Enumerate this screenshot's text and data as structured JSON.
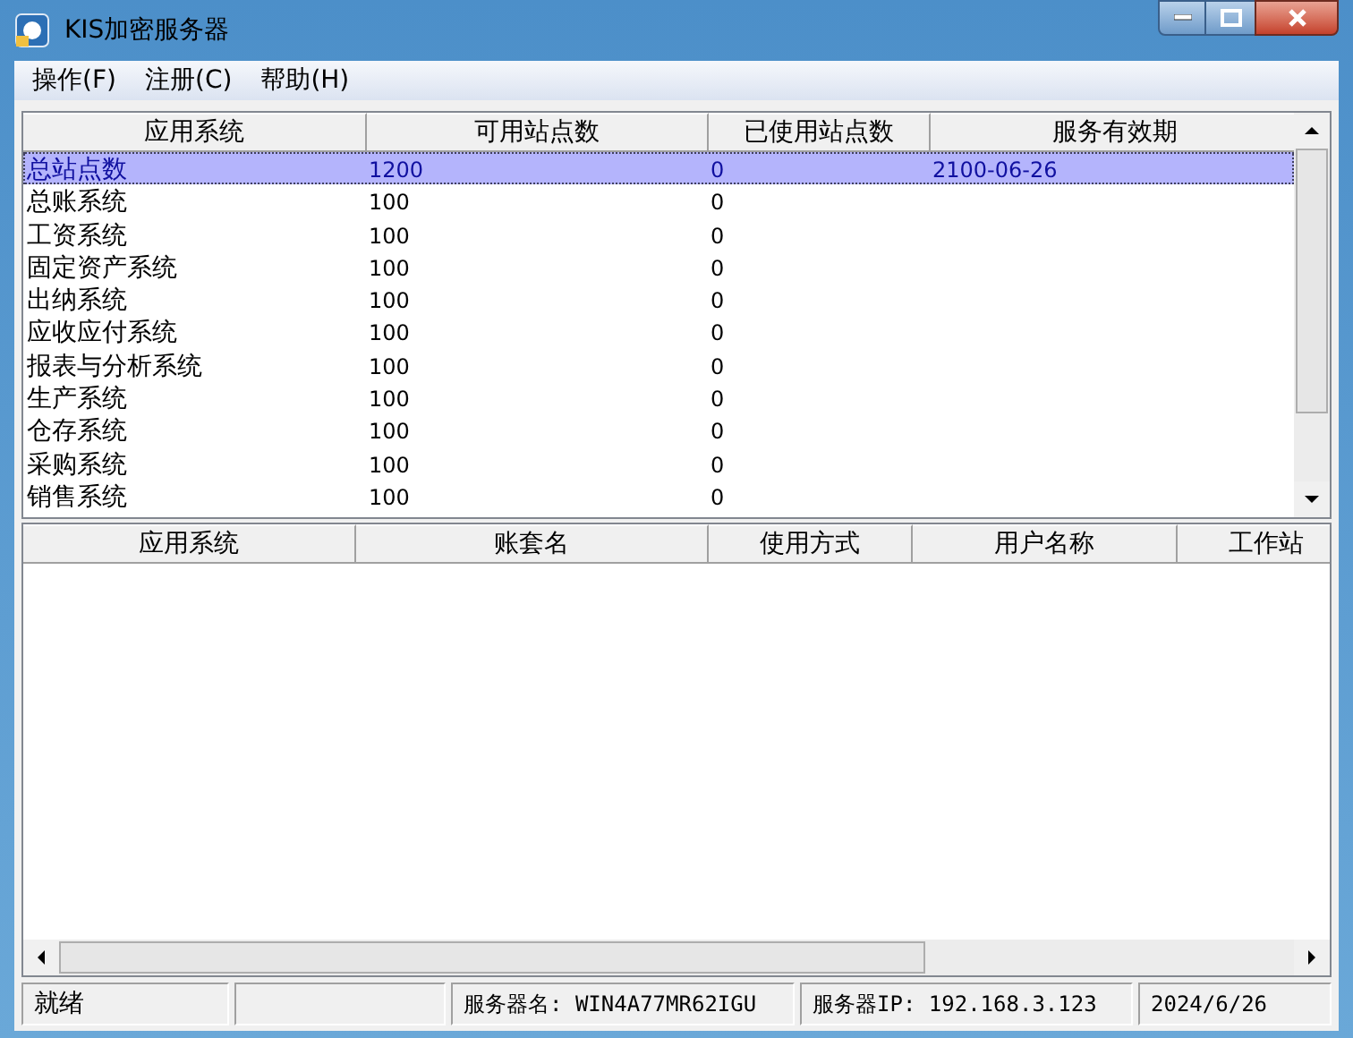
{
  "window": {
    "title": "KIS加密服务器"
  },
  "menu": [
    "操作(F)",
    "注册(C)",
    "帮助(H)"
  ],
  "license_table": {
    "columns": [
      "应用系统",
      "可用站点数",
      "已使用站点数",
      "服务有效期"
    ],
    "rows": [
      {
        "cells": [
          "总站点数",
          "1200",
          "0",
          "2100-06-26"
        ],
        "selected": true
      },
      {
        "cells": [
          "总账系统",
          "100",
          "0"
        ],
        "selected": false
      },
      {
        "cells": [
          "工资系统",
          "100",
          "0"
        ],
        "selected": false
      },
      {
        "cells": [
          "固定资产系统",
          "100",
          "0"
        ],
        "selected": false
      },
      {
        "cells": [
          "出纳系统",
          "100",
          "0"
        ],
        "selected": false
      },
      {
        "cells": [
          "应收应付系统",
          "100",
          "0"
        ],
        "selected": false
      },
      {
        "cells": [
          "报表与分析系统",
          "100",
          "0"
        ],
        "selected": false
      },
      {
        "cells": [
          "生产系统",
          "100",
          "0"
        ],
        "selected": false
      },
      {
        "cells": [
          "仓存系统",
          "100",
          "0"
        ],
        "selected": false
      },
      {
        "cells": [
          "采购系统",
          "100",
          "0"
        ],
        "selected": false
      },
      {
        "cells": [
          "销售系统",
          "100",
          "0"
        ],
        "selected": false
      }
    ]
  },
  "session_table": {
    "columns": [
      "应用系统",
      "账套名",
      "使用方式",
      "用户名称",
      "工作站"
    ]
  },
  "status_bar": [
    {
      "kind": "text",
      "text": "就绪"
    },
    {
      "kind": "blank"
    },
    {
      "kind": "text",
      "text": "服务器名: WIN4A77MR62IGU"
    },
    {
      "kind": "text",
      "text": "服务器IP: 192.168.3.123"
    },
    {
      "kind": "text",
      "text": "2024/6/26"
    }
  ]
}
